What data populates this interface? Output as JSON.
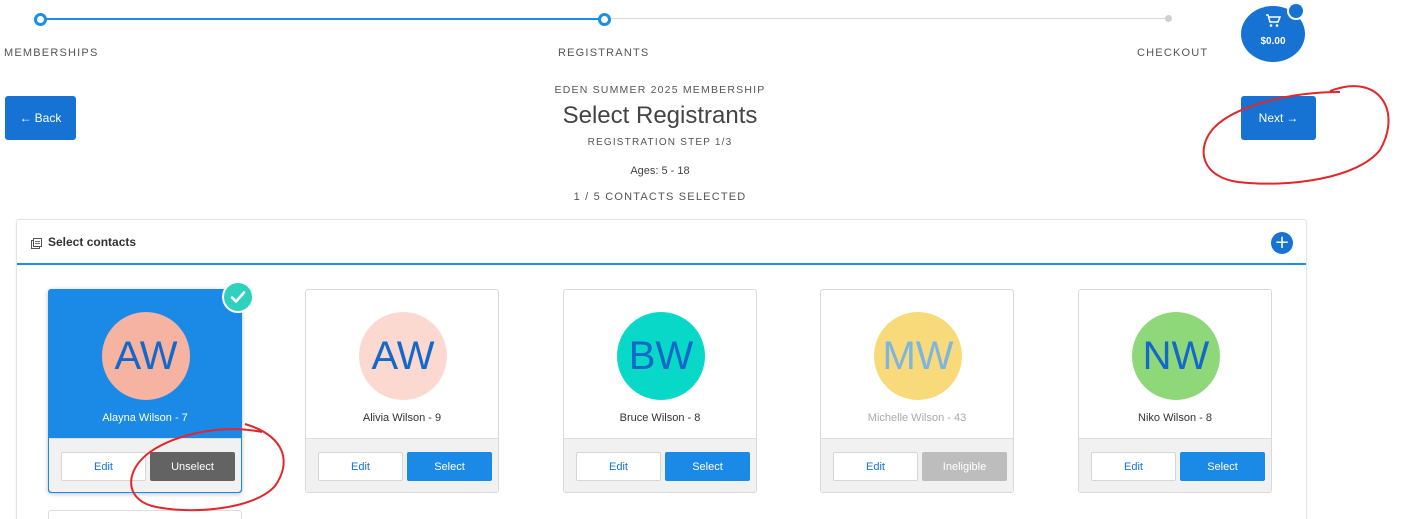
{
  "steps": [
    {
      "label": "MEMBERSHIPS",
      "state": "complete"
    },
    {
      "label": "REGISTRANTS",
      "state": "current"
    },
    {
      "label": "CHECKOUT",
      "state": "upcoming"
    }
  ],
  "cart": {
    "total": "$0.00",
    "icon": "cart-icon"
  },
  "nav": {
    "back_label": "Back",
    "next_label": "Next"
  },
  "header": {
    "subtitle": "EDEN SUMMER 2025 MEMBERSHIP",
    "title": "Select Registrants",
    "step": "REGISTRATION STEP 1/3",
    "ages": "Ages: 5 - 18",
    "selected_count": "1 / 5 CONTACTS SELECTED"
  },
  "panel": {
    "title": "Select contacts",
    "add_icon": "plus-icon"
  },
  "contacts": [
    {
      "initials": "AW",
      "name": "Alayna Wilson - 7",
      "avatar_color": "#f6b3a1",
      "edit_label": "Edit",
      "action_label": "Unselect",
      "state": "selected"
    },
    {
      "initials": "AW",
      "name": "Alivia Wilson - 9",
      "avatar_color": "#fbd9d0",
      "edit_label": "Edit",
      "action_label": "Select",
      "state": "default"
    },
    {
      "initials": "BW",
      "name": "Bruce Wilson - 8",
      "avatar_color": "#08d8c8",
      "edit_label": "Edit",
      "action_label": "Select",
      "state": "default"
    },
    {
      "initials": "MW",
      "name": "Michelle Wilson - 43",
      "avatar_color": "#f9da7a",
      "edit_label": "Edit",
      "action_label": "Ineligible",
      "state": "ineligible"
    },
    {
      "initials": "NW",
      "name": "Niko Wilson - 8",
      "avatar_color": "#8fd87a",
      "edit_label": "Edit",
      "action_label": "Select",
      "state": "default"
    }
  ],
  "colors": {
    "primary": "#1673d4",
    "selected_card": "#1a8ae6",
    "check_badge": "#2ed1bd",
    "annotation": "#e3262b"
  }
}
